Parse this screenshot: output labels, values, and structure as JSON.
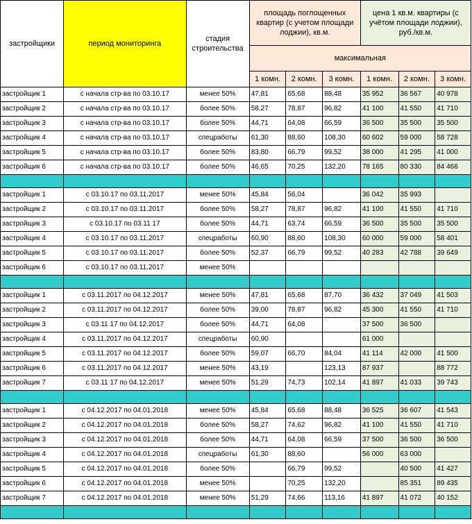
{
  "header": {
    "developers": "застройщики",
    "period": "период мониторинга",
    "stage": "стадия строительства",
    "area": "площадь поглощенных квартир (с учетом площади лоджии), кв.м.",
    "price": "цена 1 кв.м. квартиры (с учётом площади лоджии), руб./кв.м.",
    "max": "максимальная",
    "rooms": [
      "1 комн.",
      "2 комн.",
      "3 комн."
    ]
  },
  "groups": [
    [
      [
        "застройщик 1",
        "с начала стр-ва по 03.10.17",
        "менее 50%",
        "47,81",
        "65,68",
        "88,48",
        "35 952",
        "36 567",
        "40 978"
      ],
      [
        "застройщик 2",
        "с начала стр-ва по 03.10.17",
        "более 50%",
        "58,27",
        "78,87",
        "96,82",
        "41 100",
        "41 550",
        "41 710"
      ],
      [
        "застройщик 3",
        "с начала стр-ва по 03.10.17",
        "более 50%",
        "44,71",
        "64,08",
        "66,59",
        "36 500",
        "35 500",
        "35 500"
      ],
      [
        "застройщик 4",
        "с начала стр-ва по 03.10.17",
        "спецработы",
        "61,30",
        "88,60",
        "108,30",
        "60 602",
        "59 000",
        "58 728"
      ],
      [
        "застройщик 5",
        "с начала стр-ва по 03.10.17",
        "более 50%",
        "83,80",
        "66,79",
        "99,52",
        "38 000",
        "41 295",
        "41 000"
      ],
      [
        "застройщик 6",
        "с начала стр-ва по 03.10.17",
        "более 50%",
        "46,65",
        "70,25",
        "132,20",
        "78 165",
        "80 330",
        "84 466"
      ]
    ],
    [
      [
        "застройщик 1",
        "с 03.10.17 по 03.11.2017",
        "менее 50%",
        "45,84",
        "56,04",
        "",
        "36 042",
        "35 993",
        ""
      ],
      [
        "застройщик 2",
        "с 03.10.17 по 03.11.2017",
        "более 50%",
        "58,27",
        "78,87",
        "96,82",
        "41 100",
        "41 550",
        "41 710"
      ],
      [
        "застройщик 3",
        "с 03.10.17 по 03.11 17",
        "более 50%",
        "44,71",
        "63,74",
        "66,59",
        "36 500",
        "35 500",
        "35 500"
      ],
      [
        "застройщик 4",
        "с 03.10.17 по 03.11.2017",
        "спецработы",
        "60,90",
        "88,60",
        "108,30",
        "60 000",
        "59 000",
        "58 401"
      ],
      [
        "застройщик 5",
        "с 03.10.17 по 03.11.2017",
        "более 50%",
        "52,37",
        "66,79",
        "99,52",
        "40 283",
        "42 788",
        "39 649"
      ],
      [
        "застройщик 6",
        "с 03.10.17 по 03.11.2017",
        "менее 50%",
        "",
        "",
        "",
        "",
        "",
        ""
      ]
    ],
    [
      [
        "застройщик 1",
        "с 03.11.2017 по 04.12.2017",
        "менее 50%",
        "47,81",
        "65,68",
        "87,70",
        "36 432",
        "37 049",
        "41 503"
      ],
      [
        "застройщик 2",
        "с 03.11.2017 по 04.12.2017",
        "более 50%",
        "39,00",
        "78,87",
        "96,82",
        "45 300",
        "41 550",
        "41 710"
      ],
      [
        "застройщик 3",
        "с 03.11 17 по 04.12.2017",
        "более 50%",
        "44,71",
        "64,08",
        "",
        "37 500",
        "36 500",
        ""
      ],
      [
        "застройщик 4",
        "с 03.11.2017 по 04.12.2017",
        "спецработы",
        "60,90",
        "",
        "",
        "61 000",
        "",
        ""
      ],
      [
        "застройщик 5",
        "с 03.11.2017 по 04.12.2017",
        "более 50%",
        "59,07",
        "66,70",
        "84,04",
        "41 114",
        "42 000",
        "41 500"
      ],
      [
        "застройщик 6",
        "с 03.11.2017 по 04.12.2017",
        "менее 50%",
        "43,19",
        "",
        "123,13",
        "87 937",
        "",
        "88 772"
      ],
      [
        "застройщик 7",
        "с 03.11 17 по 04.12.2017",
        "менее 50%",
        "51,29",
        "74,73",
        "102,14",
        "41 897",
        "41 033",
        "39 743"
      ]
    ],
    [
      [
        "застройщик 1",
        "с 04.12.2017 по 04.01.2018",
        "менее 50%",
        "45,84",
        "65,68",
        "88,48",
        "36 525",
        "36 607",
        "41 543"
      ],
      [
        "застройщик 2",
        "с 04.12.2017 по 04.01.2018",
        "более 50%",
        "58,27",
        "74,62",
        "96,82",
        "41 100",
        "41 550",
        "41 710"
      ],
      [
        "застройщик 3",
        "с 04.12.2017 по 04.01.2018",
        "более 50%",
        "44,71",
        "64,08",
        "66,59",
        "37 500",
        "36 500",
        "36 500"
      ],
      [
        "застройщик 4",
        "с 04.12.2017 по 04.01.2018",
        "спецработы",
        "61,30",
        "88,60",
        "",
        "56 000",
        "63 000",
        ""
      ],
      [
        "застройщик 5",
        "с 04.12.2017 по 04.01.2018",
        "более 50%",
        "",
        "66,79",
        "99,52",
        "",
        "40 500",
        "41 427"
      ],
      [
        "застройщик 6",
        "с 04.12.2017 по 04.01.2018",
        "менее 50%",
        "",
        "70,25",
        "132,20",
        "",
        "85 351",
        "89 435"
      ],
      [
        "застройщик 7",
        "с 04.12.2017 по 04.01.2018",
        "менее 50%",
        "51,29",
        "74,66",
        "113,16",
        "41 897",
        "41 072",
        "40 152"
      ]
    ]
  ]
}
